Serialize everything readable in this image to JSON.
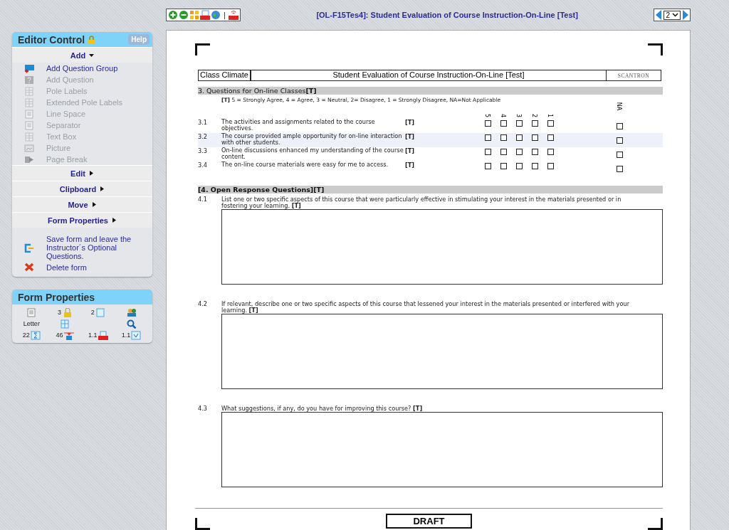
{
  "editor_control": {
    "title": "Editor Control",
    "help": "Help",
    "sections": [
      {
        "label": "Add",
        "expanded": true,
        "items": [
          {
            "label": "Add Question Group",
            "kind": "folder",
            "disabled": false
          },
          {
            "label": "Add Question",
            "kind": "question",
            "disabled": true
          },
          {
            "label": "Pole Labels",
            "kind": "grid",
            "disabled": true
          },
          {
            "label": "Extended Pole Labels",
            "kind": "grid",
            "disabled": true
          },
          {
            "label": "Line Space",
            "kind": "doc",
            "disabled": true
          },
          {
            "label": "Separator",
            "kind": "doc",
            "disabled": true
          },
          {
            "label": "Text Box",
            "kind": "grid",
            "disabled": true
          },
          {
            "label": "Picture",
            "kind": "picture",
            "disabled": true
          },
          {
            "label": "Page Break",
            "kind": "arrow",
            "disabled": true
          }
        ]
      },
      {
        "label": "Edit",
        "expanded": false
      },
      {
        "label": "Clipboard",
        "expanded": false
      },
      {
        "label": "Move",
        "expanded": false
      },
      {
        "label": "Form Properties",
        "expanded": false
      }
    ],
    "actions": [
      {
        "label": "Save form and leave the Instructor´s Optional Questions.",
        "kind": "exit"
      },
      {
        "label": "Delete form",
        "kind": "delete"
      }
    ]
  },
  "form_properties": {
    "title": "Form Properties",
    "cells": [
      {
        "kind": "doc"
      },
      {
        "kind": "lock",
        "value": "3"
      },
      {
        "kind": "page",
        "value": "2"
      },
      {
        "kind": "people"
      },
      {
        "kind": "text",
        "value": "Letter"
      },
      {
        "kind": "grid"
      },
      {
        "kind": "none"
      },
      {
        "kind": "search"
      },
      {
        "kind": "sum",
        "value": "22"
      },
      {
        "kind": "mark",
        "value": "46"
      },
      {
        "kind": "pdf",
        "value": "1.1"
      },
      {
        "kind": "check",
        "value": "1.1"
      }
    ]
  },
  "toolbar": {
    "separator": "|"
  },
  "title": "[OL-F15Tes4]: Student Evaluation of Course Instruction-On-Line [Test]",
  "pager": {
    "page": "2"
  },
  "form": {
    "header": {
      "left": "Class Climate",
      "center": "Student Evaluation of Course Instruction-On-Line [Test]",
      "logo": "SCANTRON"
    },
    "rating_section": {
      "title": "3. Questions for On-line Classes",
      "tag": "[T]",
      "legend_tag": "[T]",
      "legend": "5 = Strongly Agree, 4 = Agree, 3 = Neutral, 2= Disagree, 1 = Strongly Disagree, NA=Not Applicable",
      "scale": [
        "5",
        "4",
        "3",
        "2",
        "1"
      ],
      "na": "NA",
      "questions": [
        {
          "number": "3.1",
          "text": "The activities and assignments related to the course objectives.",
          "tag": "[T]",
          "highlighted": false,
          "choices": [
            {
              "checked": false
            },
            {
              "checked": false
            },
            {
              "checked": false
            },
            {
              "checked": false
            },
            {
              "checked": false
            },
            {
              "checked": false
            }
          ]
        },
        {
          "number": "3.2",
          "text": "The course provided ample opportunity for on-line interaction with other students.",
          "tag": "[T]",
          "highlighted": true,
          "choices": [
            {
              "checked": false
            },
            {
              "checked": false
            },
            {
              "checked": false
            },
            {
              "checked": false
            },
            {
              "checked": false
            },
            {
              "checked": false
            }
          ]
        },
        {
          "number": "3.3",
          "text": "On-line discussions enhanced my understanding of the course content.",
          "tag": "[T]",
          "highlighted": false,
          "choices": [
            {
              "checked": false
            },
            {
              "checked": false
            },
            {
              "checked": false
            },
            {
              "checked": false
            },
            {
              "checked": false
            },
            {
              "checked": false
            }
          ]
        },
        {
          "number": "3.4",
          "text": "The on-line course materials were easy for me to access.",
          "tag": "[T]",
          "highlighted": false,
          "choices": [
            {
              "checked": false
            },
            {
              "checked": false
            },
            {
              "checked": false
            },
            {
              "checked": false
            },
            {
              "checked": false
            },
            {
              "checked": false
            }
          ]
        }
      ]
    },
    "open_section": {
      "title": "[4. Open Response Questions][T]",
      "questions": [
        {
          "number": "4.1",
          "text": "List one or two specific aspects of this course that were particularly effective in stimulating your interest in the materials presented or in fostering your learning. **[T]**"
        },
        {
          "number": "4.2",
          "text": "If relevant, describe one or two specific aspects of this course that lessened your interest in the materials presented or interfered with your learning. **[T]**"
        },
        {
          "number": "4.3",
          "text": "What suggestions, if any, do you have for improving this course? **[T]**"
        }
      ]
    },
    "footer": "DRAFT"
  }
}
